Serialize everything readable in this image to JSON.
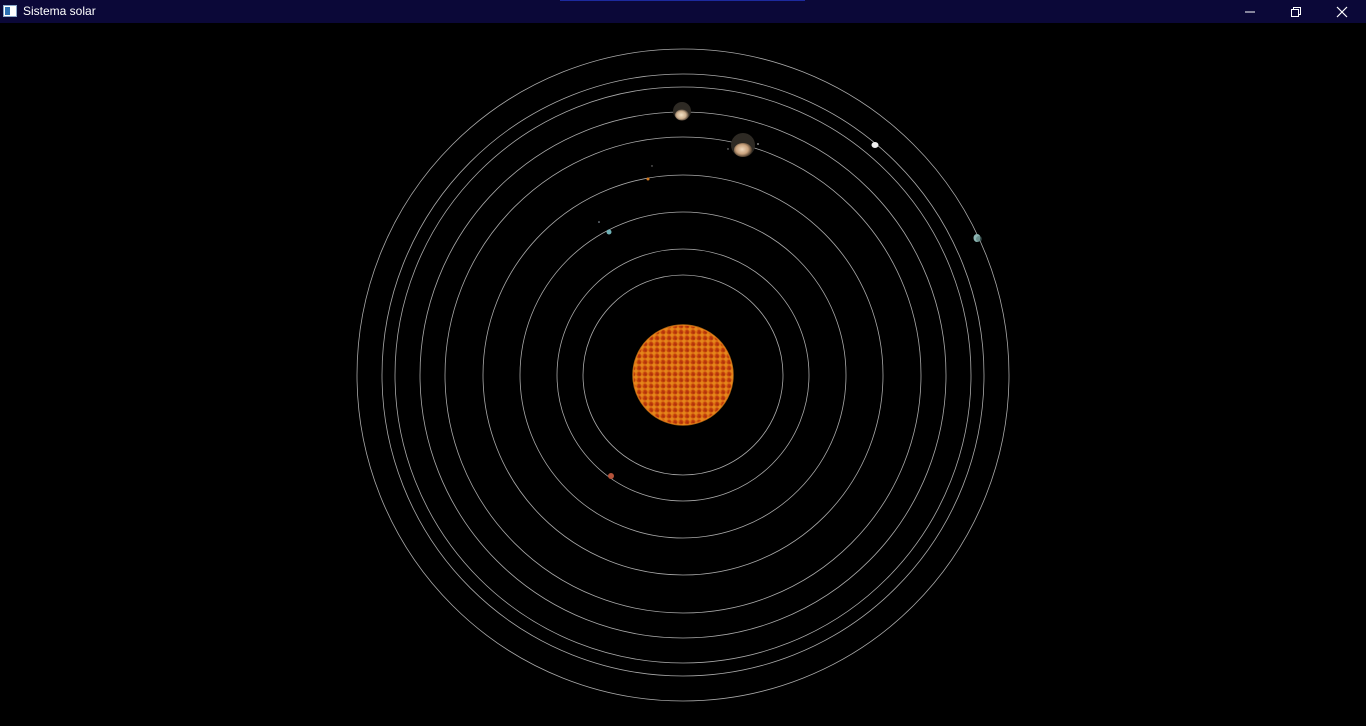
{
  "window": {
    "title": "Sistema solar",
    "icon": "app-window-icon",
    "controls": [
      "minimize-icon",
      "restore-icon",
      "close-icon"
    ]
  },
  "colors": {
    "titlebar": "#0b0838",
    "background": "#000000",
    "orbit": "#c8c8c8",
    "sun": "#c2410c"
  },
  "scene": {
    "orbit_count": 9,
    "bodies": [
      "sun",
      "mercury",
      "venus",
      "earth",
      "mars",
      "jupiter",
      "saturn",
      "uranus",
      "neptune",
      "pluto"
    ]
  }
}
